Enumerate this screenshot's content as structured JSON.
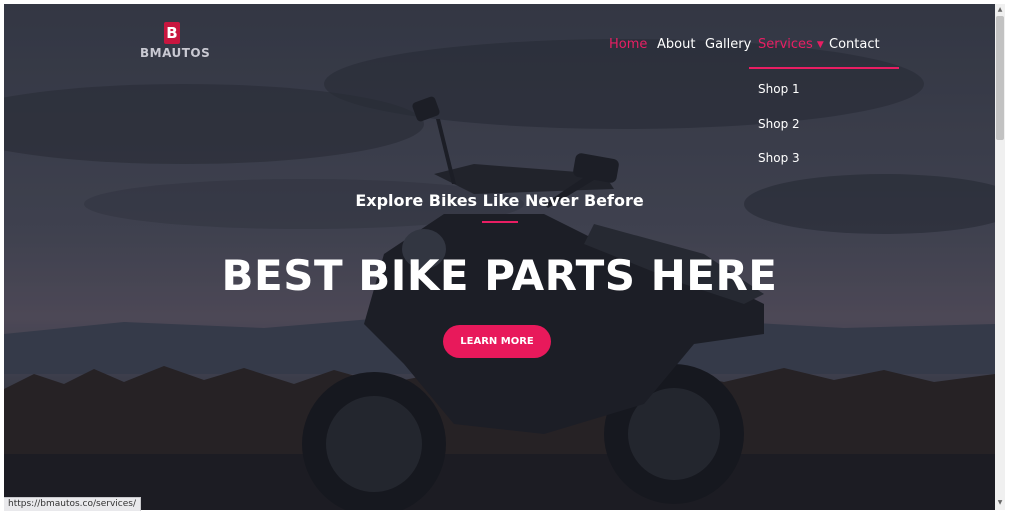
{
  "logo": {
    "mark": "B",
    "text": "BMAUTOS"
  },
  "nav": {
    "items": [
      {
        "label": "Home",
        "active": true
      },
      {
        "label": "About",
        "active": false
      },
      {
        "label": "Gallery",
        "active": false
      },
      {
        "label": "Services",
        "active": true,
        "dropdown": true
      },
      {
        "label": "Contact",
        "active": false
      }
    ]
  },
  "dropdown": {
    "items": [
      "Shop 1",
      "Shop 2",
      "Shop 3"
    ]
  },
  "hero": {
    "subtitle": "Explore Bikes Like Never Before",
    "title": "BEST BIKE PARTS HERE",
    "cta": "LEARN MORE"
  },
  "status_url": "https://bmautos.co/services/",
  "colors": {
    "accent": "#e91e63",
    "overlay": "#2c3140"
  },
  "icons": {
    "services_caret": "chevron-down-icon"
  }
}
